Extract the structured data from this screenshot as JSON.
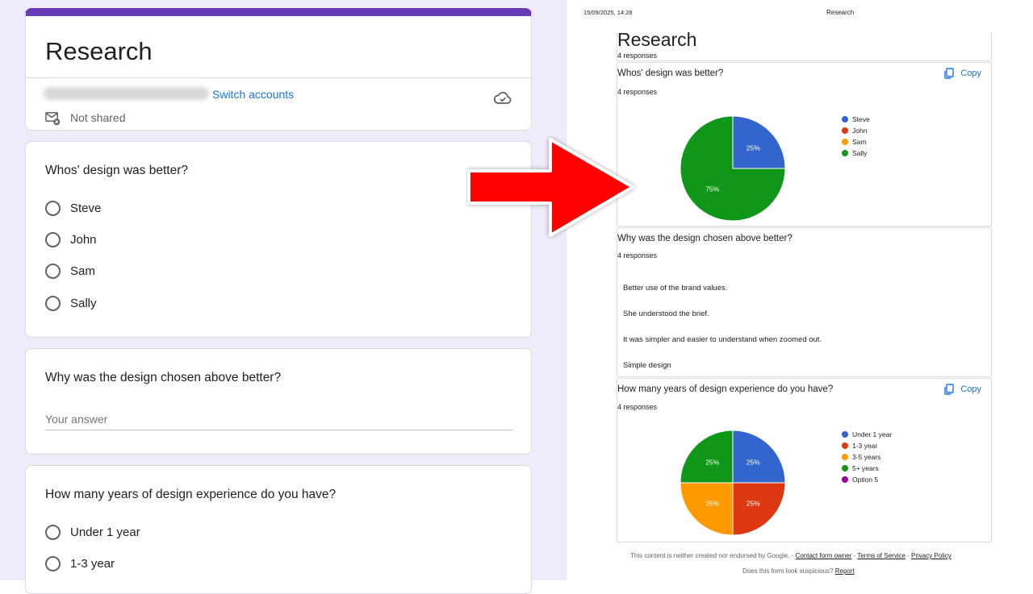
{
  "form": {
    "title": "Research",
    "switch_accounts": "Switch accounts",
    "not_shared": "Not shared",
    "q1": {
      "text": "Whos' design was better?",
      "options": [
        "Steve",
        "John",
        "Sam",
        "Sally"
      ]
    },
    "q2": {
      "text": "Why was the design chosen above better?",
      "placeholder": "Your answer"
    },
    "q3": {
      "text": "How many years of design experience do you have?",
      "options": [
        "Under 1 year",
        "1-3 year"
      ]
    }
  },
  "results": {
    "timestamp": "15/09/2025, 14:28",
    "page_title": "Research",
    "title": "Research",
    "responses": "4 responses",
    "copy_label": "Copy",
    "q1": {
      "text": "Whos' design was better?",
      "responses": "4 responses",
      "legend": [
        "Steve",
        "John",
        "Sam",
        "Sally"
      ],
      "slice_labels": [
        "75%",
        "25%"
      ]
    },
    "q2": {
      "text": "Why was the design chosen above better?",
      "responses": "4 responses",
      "answers": [
        "Better use of the brand values.",
        "She understood the brief.",
        "It was simpler and easier to understand when zoomed out.",
        "Simple design"
      ]
    },
    "q3": {
      "text": "How many years of design experience do you have?",
      "responses": "4 responses",
      "legend": [
        "Under 1 year",
        "1-3 year",
        "3-5 years",
        "5+ years",
        "Option 5"
      ],
      "slice_labels": [
        "25%",
        "25%",
        "25%",
        "25%"
      ]
    },
    "footer": {
      "line1_prefix": "This content is neither created nor endorsed by Google. - ",
      "contact": "Contact form owner",
      "sep1": " - ",
      "terms": "Terms of Service",
      "sep2": " - ",
      "privacy": "Privacy Policy",
      "line2_prefix": "Does this form look suspicious? ",
      "report": "Report"
    }
  },
  "colors": {
    "accent": "#673ab7",
    "blue": "#3366cc",
    "red": "#dc3912",
    "orange": "#ff9900",
    "green": "#109618",
    "purple": "#990099",
    "arrow": "#ff0000"
  },
  "chart_data": [
    {
      "type": "pie",
      "title": "Whos' design was better?",
      "categories": [
        "Steve",
        "John",
        "Sam",
        "Sally"
      ],
      "values": [
        1,
        0,
        0,
        3
      ],
      "legend": "right"
    },
    {
      "type": "pie",
      "title": "How many years of design experience do you have?",
      "categories": [
        "Under 1 year",
        "1-3 year",
        "3-5 years",
        "5+ years",
        "Option 5"
      ],
      "values": [
        1,
        1,
        1,
        1,
        0
      ],
      "legend": "right"
    }
  ]
}
